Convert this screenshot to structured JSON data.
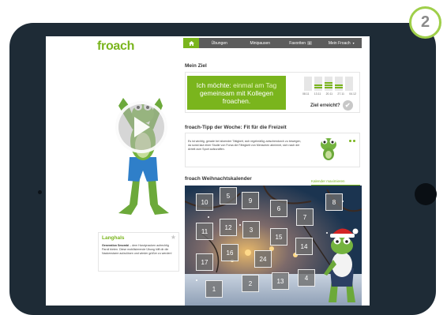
{
  "step_number": "2",
  "app": {
    "logo": "froach"
  },
  "nav": {
    "items": [
      "Übungen",
      "Minipausen",
      "Favoriten",
      "Mein Froach"
    ],
    "favoriten_count": "0"
  },
  "goal": {
    "title": "Mein Ziel",
    "text_prefix": "Ich möchte: ",
    "text_highlight": "einmal am Tag",
    "text_rest": "gemeinsam mit Kollegen froachen.",
    "dates": [
      "08.11",
      "13.11",
      "20.11",
      "27.11",
      "04.12"
    ],
    "question": "Ziel erreicht?"
  },
  "tip": {
    "title": "froach-Tipp der Woche: Fit für die Freizeit",
    "text": "Es ist wichtig, gerade bei sitzender Tätigkeit, sich regelmäßig zwischendurch zu bewegen, da sonst laut einer Studie von Forsa die Fähigkeit von Menschen abnimmt, sich nach der Arbeit zum Sport aufzuraffen."
  },
  "calendar": {
    "title": "froach Weihnachtskalender",
    "maximize_link": "Kalender maximieren",
    "doors": [
      "10",
      "5",
      "9",
      "6",
      "7",
      "8",
      "11",
      "12",
      "3",
      "15",
      "14",
      "17",
      "16",
      "24",
      "4",
      "13",
      "2",
      "1"
    ]
  },
  "long_card": {
    "title": "Langhals",
    "bold": "Generation Smombi",
    "text": " – dem Handynacken aufrechtig Paroli bieten. Diese mobilisierende Übung hilft dir die Nackenstarre aufzulösen und wieder größer zu werden!"
  },
  "colors": {
    "brand_green": "#7ab51d",
    "nav_bg": "#5c5c5c",
    "tablet_frame": "#1e2b36",
    "badge_ring": "#9fcf4a"
  }
}
